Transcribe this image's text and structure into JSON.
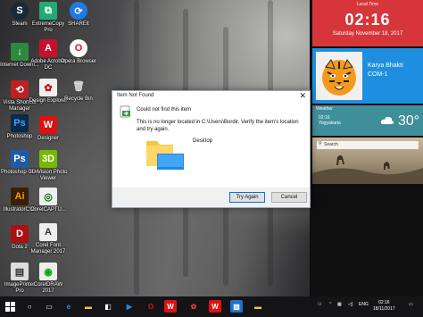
{
  "desktop": {
    "icons": [
      {
        "label": "Steam"
      },
      {
        "label": "Internet Downl..."
      },
      {
        "label": "Vista Shortcut Manager"
      },
      {
        "label": "Photoshop"
      },
      {
        "label": "Photoshop CS4"
      },
      {
        "label": "IllustratorCS6"
      },
      {
        "label": "Dota 2"
      },
      {
        "label": "ImagePrinter Pro"
      },
      {
        "label": "ExtremeCopy Pro"
      },
      {
        "label": "Adobe Acrobat DC"
      },
      {
        "label": "Design Explorer"
      },
      {
        "label": "Designer"
      },
      {
        "label": "3D Vision Photo Viewer"
      },
      {
        "label": "CorelCAPTU..."
      },
      {
        "label": "Corel Font Manager 2017"
      },
      {
        "label": "CorelDRAW 2017"
      },
      {
        "label": "SHAREit"
      },
      {
        "label": "Opera Browser"
      },
      {
        "label": "Recycle Bin"
      }
    ]
  },
  "tiles": {
    "clock": {
      "header": "Local Time",
      "time": "02:16",
      "date": "Saturday November 18, 2017"
    },
    "team": {
      "name": "Karya Bhakti",
      "score": "COM-1"
    },
    "weather": {
      "header": "Weather",
      "time": "02:16",
      "place": "Yogyakarta",
      "temp": "30°"
    },
    "search": {
      "placeholder": "Search"
    }
  },
  "dialog": {
    "title": "Item Not Found",
    "heading": "Could not find this item",
    "body": "This is no longer located in C:\\Users\\Bordir. Verify the item's location and try again.",
    "item_name": "Desktop",
    "primary_button": "Try Again",
    "cancel_button": "Cancel"
  },
  "taskbar": {
    "language": "ENG",
    "clock_time": "02:16",
    "clock_date": "18/11/2017"
  },
  "colors": {
    "clock_tile": "#d6363a",
    "team_tile": "#1e8fe0",
    "weather_tile": "#3f8f9a",
    "taskbar": "#141416",
    "primary_border": "#0078d7"
  }
}
